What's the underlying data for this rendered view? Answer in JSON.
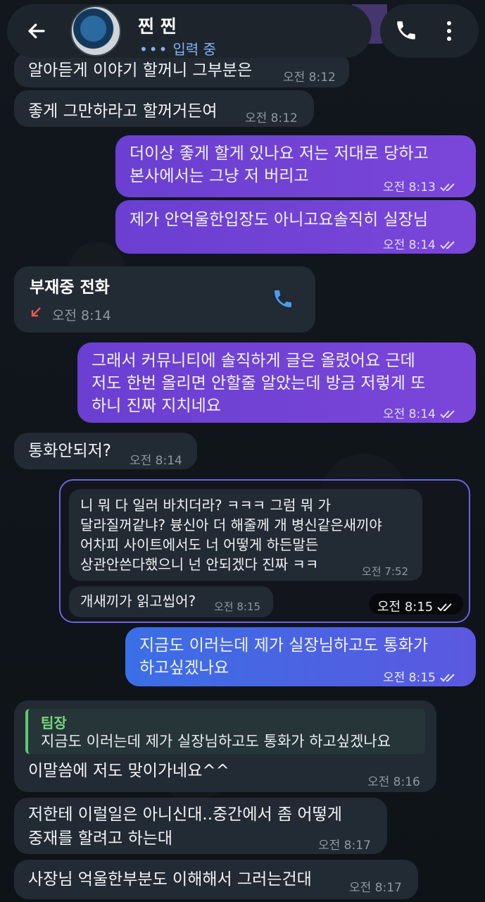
{
  "header": {
    "contact_name": "찐 찐",
    "status": "입력 중",
    "typing_dots": "•••"
  },
  "messages": {
    "m1": {
      "text": "알아듣게 이야기 할꺼니 그부분은",
      "time": "오전 8:12"
    },
    "m2": {
      "text": "좋게 그만하라고 할꺼거든여",
      "time": "오전 8:12"
    },
    "m3": {
      "line1": "더이상 좋게 할게 있나요 저는 저대로 당하고",
      "line2": "본사에서는 그냥 저 버리고",
      "time": "오전 8:13"
    },
    "m4": {
      "text": "제가 안억울한입장도 아니고요솔직히 실장님",
      "time": "오전 8:14"
    },
    "missed_call": {
      "title": "부재중 전화",
      "time": "오전 8:14"
    },
    "m5": {
      "line1": "그래서 커뮤니티에 솔직하게 글은 올렸어요 근데",
      "line2": "저도 한번 올리면 안할줄 알았는데 방금 저렇게 또",
      "line3": "하니 진짜 지치네요",
      "time": "오전 8:14"
    },
    "m6": {
      "text": "통화안되저?",
      "time": "오전 8:14"
    },
    "fwd": {
      "q1": {
        "line1": "니 뭐 다 일러 바치더라? ㅋㅋㅋ 그럼 뭐 가",
        "line2": "달라질꺼같냐? 븅신아 더 해줄께 개 병신같은새끼야",
        "line3": "어차피 사이트에서도 너 어떻게 하든말든",
        "line4": "상관안쓴다했으니 넌 안되겠다 진짜 ㅋㅋ",
        "time": "오전 7:52"
      },
      "q2": {
        "text": "개새끼가 읽고씹어?",
        "time": "오전 8:15"
      },
      "time": "오전 8:15"
    },
    "m7": {
      "line1": "지금도 이러는데 제가 실장님하고도 통화가",
      "line2": "하고싶겠나요",
      "time": "오전 8:15"
    },
    "m8": {
      "quote_author": "팀장",
      "quote_text": "지금도 이러는데 제가 실장님하고도 통화가 하고싶겠나요",
      "text": "이말씀에 저도 맞이가네요^^",
      "time": "오전 8:16"
    },
    "m9": {
      "line1": "저한테 이럴일은 아니신대..중간에서 좀 어떻게",
      "line2": "중재를 할려고 하는대",
      "time": "오전 8:17"
    },
    "m10": {
      "text": "사장님 억울한부분도 이해해서 그러는건대",
      "time": "오전 8:17"
    }
  },
  "colors": {
    "outgoing": "#7343d6",
    "incoming": "#222a33",
    "accent_blue": "#4a8cf0",
    "quote_green": "#5ec96e",
    "missed_red": "#e8574d"
  },
  "icons": [
    "back-arrow-icon",
    "phone-icon",
    "more-vertical-icon",
    "double-check-icon",
    "missed-call-arrow-icon"
  ]
}
